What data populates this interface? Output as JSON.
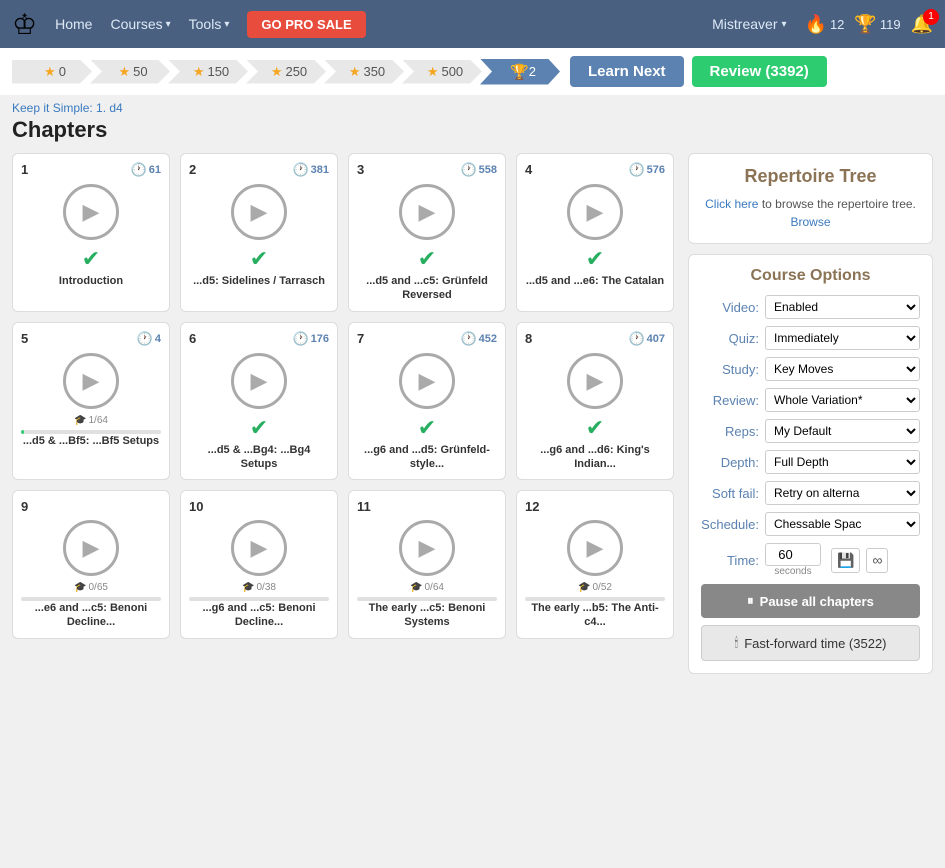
{
  "nav": {
    "home": "Home",
    "courses": "Courses",
    "tools": "Tools",
    "go_pro": "GO PRO SALE",
    "user": "Mistreaver",
    "flame_count": "12",
    "trophy_count": "119",
    "bell_badge": "1"
  },
  "progress_steps": [
    {
      "label": "0",
      "active": false
    },
    {
      "label": "50",
      "active": false
    },
    {
      "label": "150",
      "active": false
    },
    {
      "label": "250",
      "active": false
    },
    {
      "label": "350",
      "active": false
    },
    {
      "label": "500",
      "active": false
    }
  ],
  "flame_step": {
    "label": "2"
  },
  "actions": {
    "learn_next": "Learn Next",
    "review": "Review (3392)"
  },
  "breadcrumb": "Keep it Simple: 1. d4",
  "page_title": "Chapters",
  "chapters": [
    {
      "num": "1",
      "clock": "61",
      "label": "Introduction",
      "completed": true,
      "study_progress": null,
      "study_text": ""
    },
    {
      "num": "2",
      "clock": "381",
      "label": "...d5: Sidelines / Tarrasch",
      "completed": true,
      "study_progress": null,
      "study_text": ""
    },
    {
      "num": "3",
      "clock": "558",
      "label": "...d5 and ...c5: Grünfeld Reversed",
      "completed": true,
      "study_progress": null,
      "study_text": ""
    },
    {
      "num": "4",
      "clock": "576",
      "label": "...d5 and ...e6: The Catalan",
      "completed": true,
      "study_progress": null,
      "study_text": ""
    },
    {
      "num": "5",
      "clock": "4",
      "label": "...d5 & ...Bf5: ...Bf5 Setups",
      "completed": false,
      "study_progress": "1/64",
      "study_pct": 2
    },
    {
      "num": "6",
      "clock": "176",
      "label": "...d5 & ...Bg4: ...Bg4 Setups",
      "completed": true,
      "study_progress": null,
      "study_text": ""
    },
    {
      "num": "7",
      "clock": "452",
      "label": "...g6 and ...d5: Grünfeld-style...",
      "completed": true,
      "study_progress": null,
      "study_text": ""
    },
    {
      "num": "8",
      "clock": "407",
      "label": "...g6 and ...d6: King's Indian...",
      "completed": true,
      "study_progress": null,
      "study_text": ""
    },
    {
      "num": "9",
      "clock": "",
      "label": "...e6 and ...c5: Benoni Decline...",
      "completed": false,
      "study_progress": "0/65",
      "study_pct": 0
    },
    {
      "num": "10",
      "clock": "",
      "label": "...g6 and ...c5: Benoni Decline...",
      "completed": false,
      "study_progress": "0/38",
      "study_pct": 0
    },
    {
      "num": "11",
      "clock": "",
      "label": "The early ...c5: Benoni Systems",
      "completed": false,
      "study_progress": "0/64",
      "study_pct": 0
    },
    {
      "num": "12",
      "clock": "",
      "label": "The early ...b5: The Anti-c4...",
      "completed": false,
      "study_progress": "0/52",
      "study_pct": 0
    }
  ],
  "sidebar": {
    "rep_tree_title": "Repertoire Tree",
    "rep_tree_text": "Click here to browse the repertoire tree.",
    "rep_tree_link": "Click here",
    "rep_tree_browse": "Browse",
    "course_options_title": "Course Options",
    "options": [
      {
        "label": "Video:",
        "value": "Enabled",
        "name": "video"
      },
      {
        "label": "Quiz:",
        "value": "Immediately",
        "name": "quiz"
      },
      {
        "label": "Study:",
        "value": "Key Moves",
        "name": "study"
      },
      {
        "label": "Review:",
        "value": "Whole Variation*",
        "name": "review"
      },
      {
        "label": "Reps:",
        "value": "My Default",
        "name": "reps"
      },
      {
        "label": "Depth:",
        "value": "Full Depth",
        "name": "depth"
      },
      {
        "label": "Soft fail:",
        "value": "Retry on alterna",
        "name": "softfail"
      },
      {
        "label": "Schedule:",
        "value": "Chessable Spac",
        "name": "schedule"
      }
    ],
    "time_label": "Time:",
    "time_value": "60",
    "time_unit": "seconds",
    "pause_btn": "Pause all chapters",
    "fastforward_btn": "Fast-forward time (3522)"
  }
}
